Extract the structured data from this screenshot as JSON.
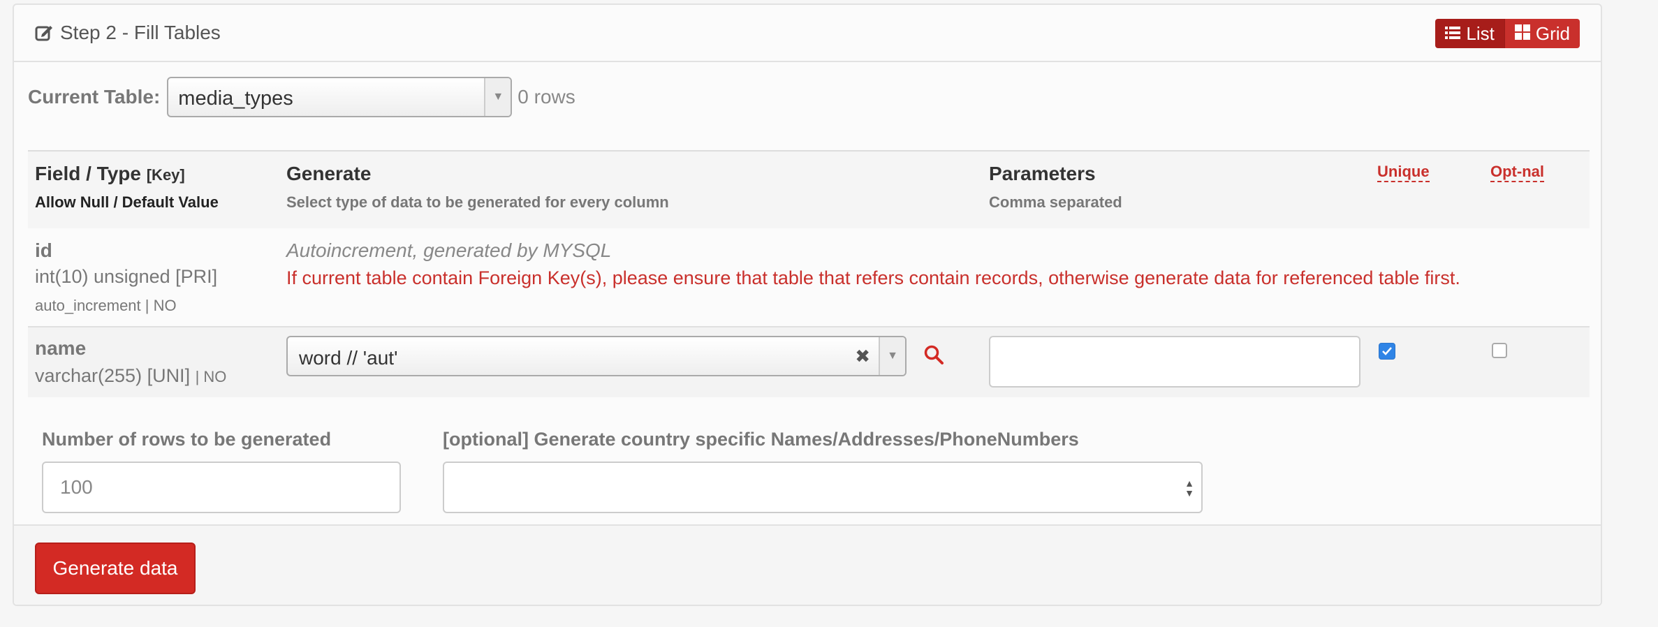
{
  "header": {
    "title": "Step 2 - Fill Tables",
    "list_label": "List",
    "grid_label": "Grid"
  },
  "current_table": {
    "label": "Current Table:",
    "value": "media_types",
    "rows": "0 rows"
  },
  "table_head": {
    "field_type": "Field / Type",
    "key": "[Key]",
    "allow_null": "Allow Null / Default Value",
    "generate": "Generate",
    "generate_sub": "Select type of data to be generated for every column",
    "parameters": "Parameters",
    "parameters_sub": "Comma separated",
    "unique": "Unique",
    "optional": "Opt-nal"
  },
  "rows": [
    {
      "name": "id",
      "type": "int(10) unsigned [PRI]",
      "extra": "auto_increment | NO",
      "note": "Autoincrement, generated by MYSQL",
      "warning": "If current table contain Foreign Key(s), please ensure that table that refers contain records, otherwise generate data for referenced table first."
    },
    {
      "name": "name",
      "type": "varchar(255) [UNI]",
      "extra": "| NO",
      "generator": "word // 'aut'",
      "parameters": "",
      "unique": true,
      "optional": false
    }
  ],
  "options": {
    "rows_label": "Number of rows to be generated",
    "rows_placeholder": "100",
    "country_label": "[optional] Generate country specific Names/Addresses/PhoneNumbers",
    "country_value": ""
  },
  "footer": {
    "generate_label": "Generate data"
  },
  "colors": {
    "accent": "#d32a24",
    "checkbox": "#2f84e6"
  },
  "icons": [
    "edit-icon",
    "list-icon",
    "grid-icon",
    "search-icon",
    "clear-icon",
    "chevron-down-icon"
  ]
}
